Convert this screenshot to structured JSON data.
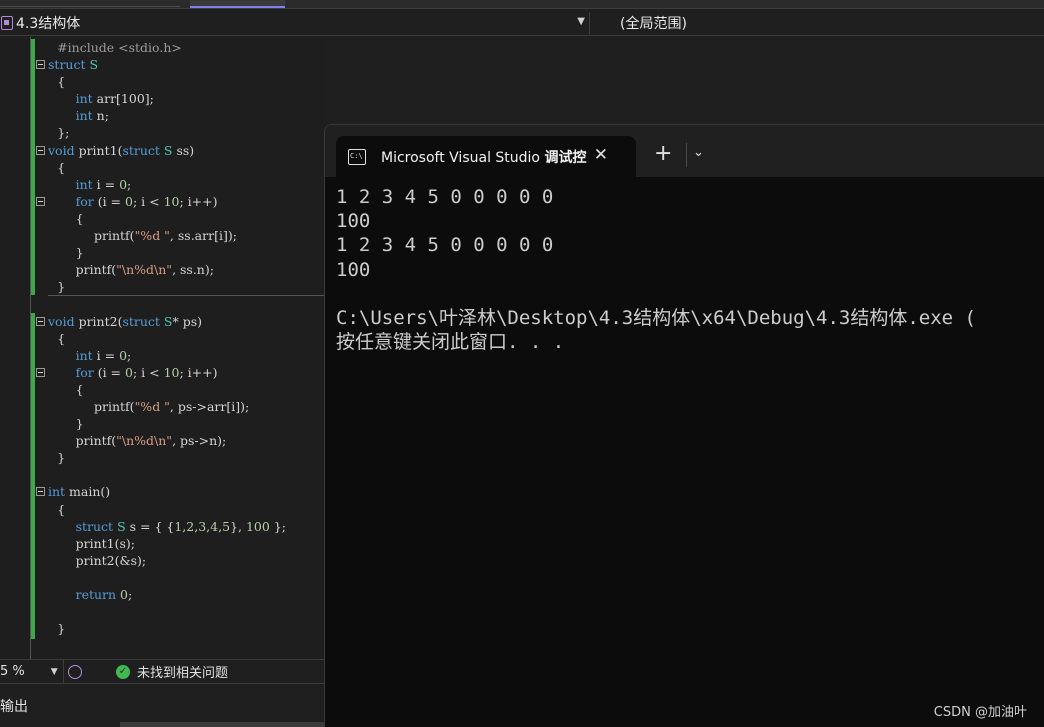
{
  "window": {
    "file_dropdown": "4.3结构体",
    "scope_dropdown": "(全局范围)"
  },
  "editor": {
    "lines": [
      {
        "indent": 1,
        "fold": false,
        "segments": [
          {
            "t": "#include <stdio.h>",
            "c": "pp"
          }
        ]
      },
      {
        "indent": 0,
        "fold": true,
        "segments": [
          {
            "t": "struct ",
            "c": "kw"
          },
          {
            "t": "S",
            "c": "ty"
          }
        ]
      },
      {
        "indent": 1,
        "fold": false,
        "segments": [
          {
            "t": "{",
            "c": ""
          }
        ]
      },
      {
        "indent": 3,
        "fold": false,
        "segments": [
          {
            "t": "int ",
            "c": "kw"
          },
          {
            "t": "arr[100];",
            "c": ""
          }
        ]
      },
      {
        "indent": 3,
        "fold": false,
        "segments": [
          {
            "t": "int ",
            "c": "kw"
          },
          {
            "t": "n;",
            "c": ""
          }
        ]
      },
      {
        "indent": 1,
        "fold": false,
        "segments": [
          {
            "t": "};",
            "c": ""
          }
        ]
      },
      {
        "indent": 0,
        "fold": true,
        "segments": [
          {
            "t": "void ",
            "c": "kw"
          },
          {
            "t": "print1(",
            "c": ""
          },
          {
            "t": "struct ",
            "c": "kw"
          },
          {
            "t": "S ",
            "c": "ty"
          },
          {
            "t": "ss)",
            "c": ""
          }
        ]
      },
      {
        "indent": 1,
        "fold": false,
        "segments": [
          {
            "t": "{",
            "c": ""
          }
        ]
      },
      {
        "indent": 3,
        "fold": false,
        "segments": [
          {
            "t": "int ",
            "c": "kw"
          },
          {
            "t": "i = ",
            "c": ""
          },
          {
            "t": "0",
            "c": "num"
          },
          {
            "t": ";",
            "c": ""
          }
        ]
      },
      {
        "indent": 3,
        "fold": true,
        "segments": [
          {
            "t": "for ",
            "c": "kw"
          },
          {
            "t": "(i = ",
            "c": ""
          },
          {
            "t": "0",
            "c": "num"
          },
          {
            "t": "; i < ",
            "c": ""
          },
          {
            "t": "10",
            "c": "num"
          },
          {
            "t": "; i++)",
            "c": ""
          }
        ]
      },
      {
        "indent": 3,
        "fold": false,
        "segments": [
          {
            "t": "{",
            "c": ""
          }
        ]
      },
      {
        "indent": 5,
        "fold": false,
        "segments": [
          {
            "t": "printf(",
            "c": ""
          },
          {
            "t": "\"%d \"",
            "c": "str"
          },
          {
            "t": ", ss.arr[i]);",
            "c": ""
          }
        ]
      },
      {
        "indent": 3,
        "fold": false,
        "segments": [
          {
            "t": "}",
            "c": ""
          }
        ]
      },
      {
        "indent": 3,
        "fold": false,
        "segments": [
          {
            "t": "printf(",
            "c": ""
          },
          {
            "t": "\"\\n%d\\n\"",
            "c": "str"
          },
          {
            "t": ", ss.n);",
            "c": ""
          }
        ]
      },
      {
        "indent": 1,
        "fold": false,
        "segments": [
          {
            "t": "}",
            "c": ""
          }
        ]
      },
      {
        "indent": 0,
        "fold": false,
        "segments": []
      },
      {
        "indent": 0,
        "fold": true,
        "segments": [
          {
            "t": "void ",
            "c": "kw"
          },
          {
            "t": "print2(",
            "c": ""
          },
          {
            "t": "struct ",
            "c": "kw"
          },
          {
            "t": "S",
            "c": "ty"
          },
          {
            "t": "* ps)",
            "c": ""
          }
        ]
      },
      {
        "indent": 1,
        "fold": false,
        "segments": [
          {
            "t": "{",
            "c": ""
          }
        ]
      },
      {
        "indent": 3,
        "fold": false,
        "segments": [
          {
            "t": "int ",
            "c": "kw"
          },
          {
            "t": "i = ",
            "c": ""
          },
          {
            "t": "0",
            "c": "num"
          },
          {
            "t": ";",
            "c": ""
          }
        ]
      },
      {
        "indent": 3,
        "fold": true,
        "segments": [
          {
            "t": "for ",
            "c": "kw"
          },
          {
            "t": "(i = ",
            "c": ""
          },
          {
            "t": "0",
            "c": "num"
          },
          {
            "t": "; i < ",
            "c": ""
          },
          {
            "t": "10",
            "c": "num"
          },
          {
            "t": "; i++)",
            "c": ""
          }
        ]
      },
      {
        "indent": 3,
        "fold": false,
        "segments": [
          {
            "t": "{",
            "c": ""
          }
        ]
      },
      {
        "indent": 5,
        "fold": false,
        "segments": [
          {
            "t": "printf(",
            "c": ""
          },
          {
            "t": "\"%d \"",
            "c": "str"
          },
          {
            "t": ", ps->arr[i]);",
            "c": ""
          }
        ]
      },
      {
        "indent": 3,
        "fold": false,
        "segments": [
          {
            "t": "}",
            "c": ""
          }
        ]
      },
      {
        "indent": 3,
        "fold": false,
        "segments": [
          {
            "t": "printf(",
            "c": ""
          },
          {
            "t": "\"\\n%d\\n\"",
            "c": "str"
          },
          {
            "t": ", ps->n);",
            "c": ""
          }
        ]
      },
      {
        "indent": 1,
        "fold": false,
        "segments": [
          {
            "t": "}",
            "c": ""
          }
        ]
      },
      {
        "indent": 0,
        "fold": false,
        "segments": []
      },
      {
        "indent": 0,
        "fold": true,
        "segments": [
          {
            "t": "int ",
            "c": "kw"
          },
          {
            "t": "main()",
            "c": ""
          }
        ]
      },
      {
        "indent": 1,
        "fold": false,
        "segments": [
          {
            "t": "{",
            "c": ""
          }
        ]
      },
      {
        "indent": 3,
        "fold": false,
        "segments": [
          {
            "t": "struct ",
            "c": "kw"
          },
          {
            "t": "S ",
            "c": "ty"
          },
          {
            "t": "s = { {",
            "c": ""
          },
          {
            "t": "1",
            "c": "num"
          },
          {
            "t": ",",
            "c": ""
          },
          {
            "t": "2",
            "c": "num"
          },
          {
            "t": ",",
            "c": ""
          },
          {
            "t": "3",
            "c": "num"
          },
          {
            "t": ",",
            "c": ""
          },
          {
            "t": "4",
            "c": "num"
          },
          {
            "t": ",",
            "c": ""
          },
          {
            "t": "5",
            "c": "num"
          },
          {
            "t": "}, ",
            "c": ""
          },
          {
            "t": "100",
            "c": "num"
          },
          {
            "t": " };",
            "c": ""
          }
        ]
      },
      {
        "indent": 3,
        "fold": false,
        "segments": [
          {
            "t": "print1(s);",
            "c": ""
          }
        ]
      },
      {
        "indent": 3,
        "fold": false,
        "segments": [
          {
            "t": "print2(&s);",
            "c": ""
          }
        ]
      },
      {
        "indent": 0,
        "fold": false,
        "segments": []
      },
      {
        "indent": 3,
        "fold": false,
        "segments": [
          {
            "t": "return ",
            "c": "kw"
          },
          {
            "t": "0",
            "c": "num"
          },
          {
            "t": ";",
            "c": ""
          }
        ]
      },
      {
        "indent": 0,
        "fold": false,
        "segments": []
      },
      {
        "indent": 1,
        "fold": false,
        "segments": [
          {
            "t": "}",
            "c": ""
          }
        ]
      }
    ]
  },
  "status": {
    "zoom": "5 %",
    "issues": "未找到相关问题"
  },
  "output_panel": {
    "title": "输出"
  },
  "terminal": {
    "tab_title_prefix": "Microsoft Visual Studio ",
    "tab_title_bold": "调试控",
    "output_lines": [
      "1 2 3 4 5 0 0 0 0 0",
      "100",
      "1 2 3 4 5 0 0 0 0 0",
      "100",
      "",
      "C:\\Users\\叶泽林\\Desktop\\4.3结构体\\x64\\Debug\\4.3结构体.exe (",
      "按任意键关闭此窗口. . ."
    ]
  },
  "watermark": "CSDN @加油叶",
  "colors": {
    "keyword": "#569cd6",
    "type": "#4ec9b0",
    "string": "#d69d85",
    "number": "#b5cea8",
    "change_bar": "#3fa84a"
  }
}
